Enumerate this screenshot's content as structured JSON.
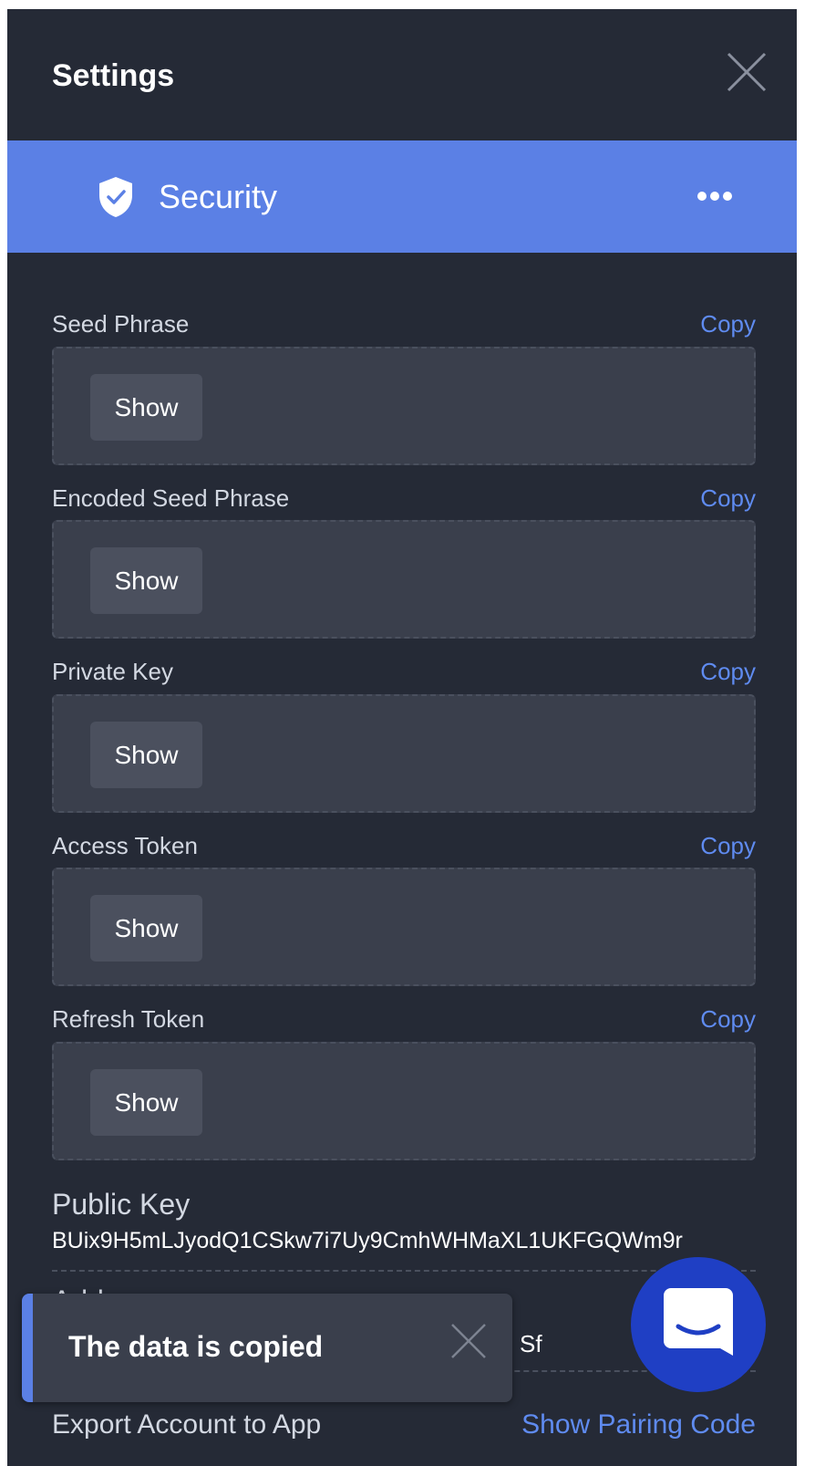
{
  "header": {
    "title": "Settings",
    "close_icon": "close-icon"
  },
  "section": {
    "title": "Security",
    "icon": "shield-check-icon",
    "more_icon": "more-horizontal-icon",
    "accent_color": "#5b80e5"
  },
  "fields": [
    {
      "label": "Seed Phrase",
      "copy_label": "Copy",
      "show_label": "Show"
    },
    {
      "label": "Encoded Seed Phrase",
      "copy_label": "Copy",
      "show_label": "Show"
    },
    {
      "label": "Private Key",
      "copy_label": "Copy",
      "show_label": "Show"
    },
    {
      "label": "Access Token",
      "copy_label": "Copy",
      "show_label": "Show"
    },
    {
      "label": "Refresh Token",
      "copy_label": "Copy",
      "show_label": "Show"
    }
  ],
  "public_key": {
    "label": "Public Key",
    "value": "BUix9H5mLJyodQ1CSkw7i7Uy9CmhWHMaXL1UKFGQWm9r"
  },
  "address": {
    "label": "Address",
    "value_visible_fragment": "Sf"
  },
  "export": {
    "label": "Export Account to App",
    "action_label": "Show Pairing Code"
  },
  "toast": {
    "message": "The data is copied",
    "close_icon": "close-icon"
  },
  "chat": {
    "icon": "chat-bubble-icon",
    "color": "#1f3fc4"
  },
  "colors": {
    "background": "#252a36",
    "link": "#5f8bf0"
  }
}
